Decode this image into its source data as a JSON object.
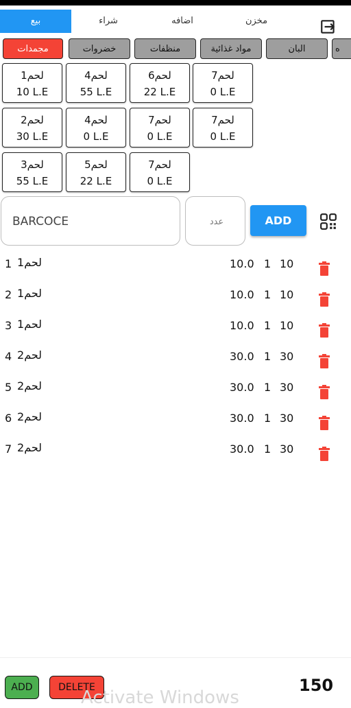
{
  "tabs": [
    "بيع",
    "شراء",
    "اضافه",
    "مخزن"
  ],
  "categories": [
    "مجمدات",
    "خضروات",
    "منظفات",
    "مواد غذائية",
    "البان",
    "ه"
  ],
  "products": [
    {
      "name": "لحم1",
      "price": "10 L.E"
    },
    {
      "name": "لحم4",
      "price": "55 L.E"
    },
    {
      "name": "لحم6",
      "price": "22 L.E"
    },
    {
      "name": "لحم7",
      "price": "0 L.E"
    },
    {
      "name": "لحم2",
      "price": "30 L.E"
    },
    {
      "name": "لحم4",
      "price": "0 L.E"
    },
    {
      "name": "لحم7",
      "price": "0 L.E"
    },
    {
      "name": "لحم7",
      "price": "0 L.E"
    },
    {
      "name": "لحم3",
      "price": "55 L.E"
    },
    {
      "name": "لحم5",
      "price": "22 L.E"
    },
    {
      "name": "لحم7",
      "price": "0 L.E"
    }
  ],
  "entry": {
    "barcode_value": "BARCOCE",
    "qty_placeholder": "عدد",
    "add_label": "ADD"
  },
  "rows": [
    {
      "idx": "1",
      "name": "لحم1",
      "price": "10.0",
      "qty": "1",
      "total": "10"
    },
    {
      "idx": "2",
      "name": "لحم1",
      "price": "10.0",
      "qty": "1",
      "total": "10"
    },
    {
      "idx": "3",
      "name": "لحم1",
      "price": "10.0",
      "qty": "1",
      "total": "10"
    },
    {
      "idx": "4",
      "name": "لحم2",
      "price": "30.0",
      "qty": "1",
      "total": "30"
    },
    {
      "idx": "5",
      "name": "لحم2",
      "price": "30.0",
      "qty": "1",
      "total": "30"
    },
    {
      "idx": "6",
      "name": "لحم2",
      "price": "30.0",
      "qty": "1",
      "total": "30"
    },
    {
      "idx": "7",
      "name": "لحم2",
      "price": "30.0",
      "qty": "1",
      "total": "30"
    }
  ],
  "footer": {
    "add_label": "ADD",
    "delete_label": "DELETE",
    "total": "150",
    "watermark": "Activate Windows"
  },
  "colors": {
    "primary": "#2196f3",
    "danger": "#f44336",
    "success": "#4caf50",
    "inactive_category": "#9e9e9e"
  }
}
